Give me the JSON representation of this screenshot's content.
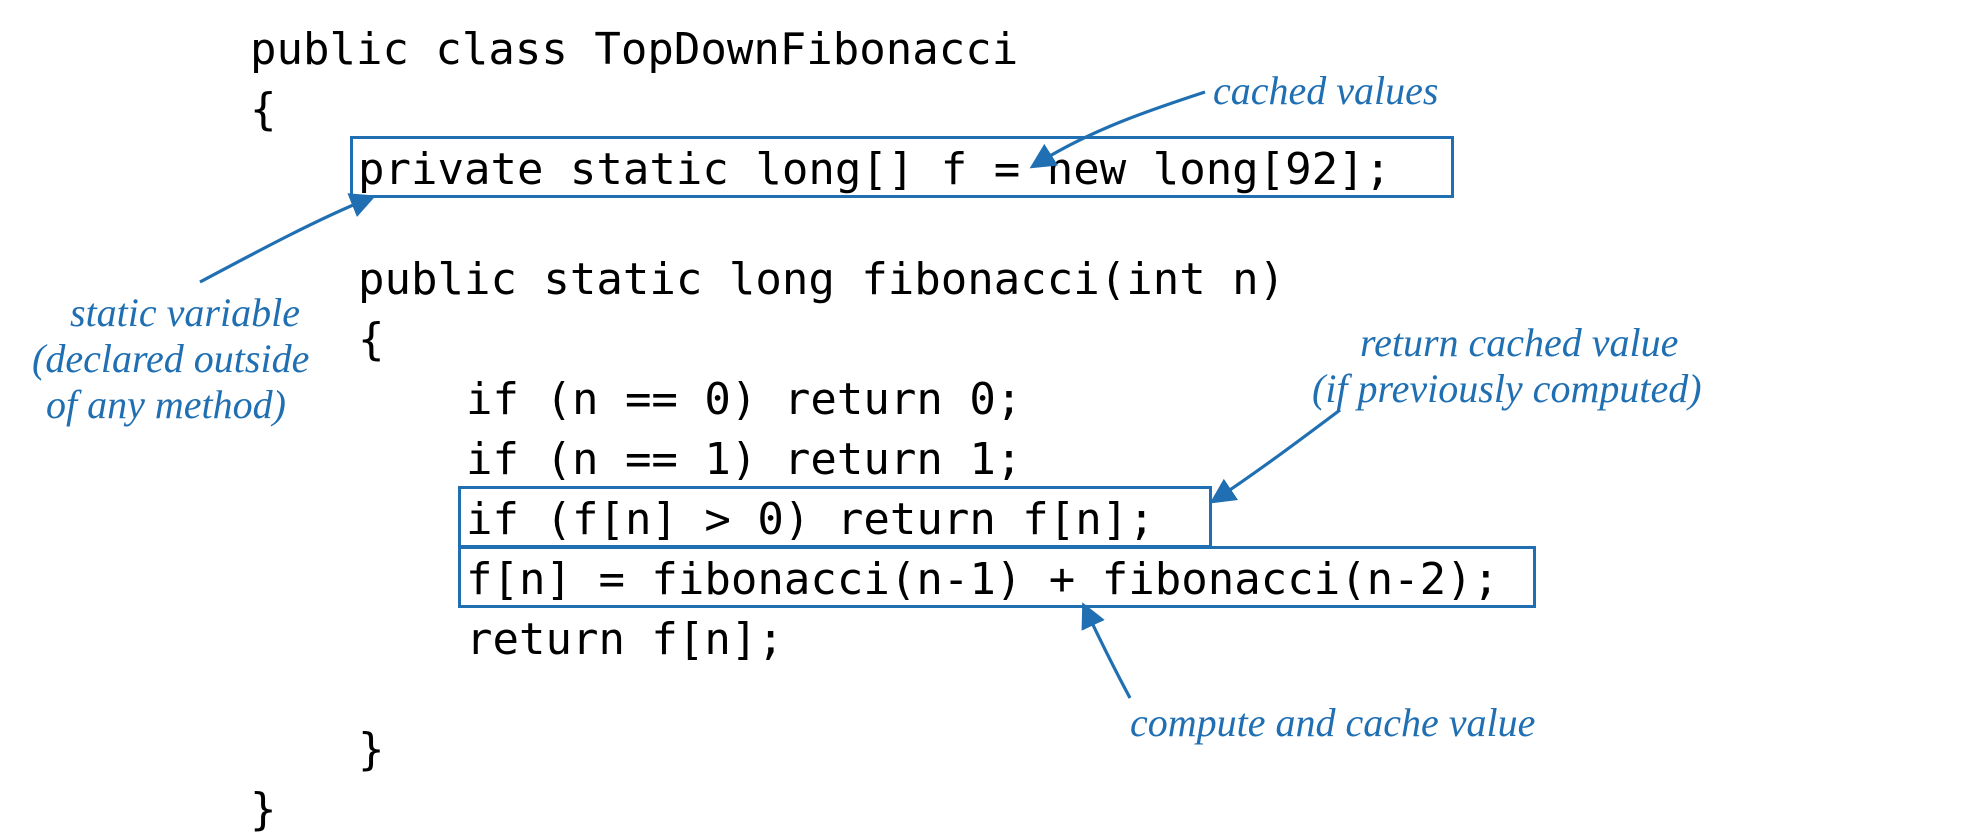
{
  "code": {
    "l1": "public class TopDownFibonacci",
    "l2": "{",
    "l3": "private static long[] f = new long[92];",
    "l4": "public static long fibonacci(int n)",
    "l5": "{",
    "l6": "if (n == 0) return 0;",
    "l7": "if (n == 1) return 1;",
    "l8": "if (f[n] > 0) return f[n];",
    "l9": "f[n] = fibonacci(n-1) + fibonacci(n-2);",
    "l10": "return f[n];",
    "l11": "}",
    "l12": "}"
  },
  "annotations": {
    "cached_values": "cached values",
    "static_var_l1": "static variable",
    "static_var_l2": "(declared outside",
    "static_var_l3": "of any method)",
    "return_cached_l1": "return cached value",
    "return_cached_l2": "(if previously computed)",
    "compute_cache": "compute and cache value"
  },
  "colors": {
    "annotation": "#1f6fb2",
    "code": "#000000"
  }
}
